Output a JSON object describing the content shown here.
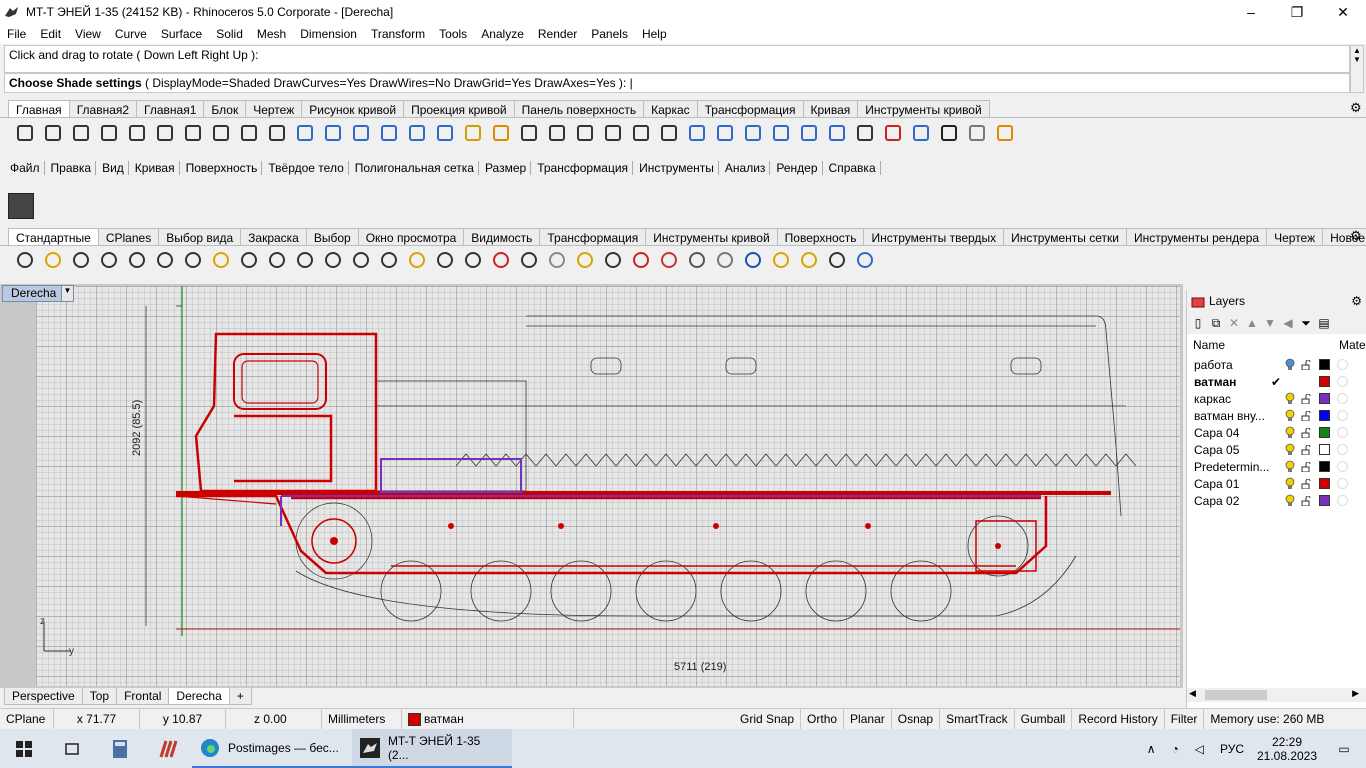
{
  "titlebar": {
    "title": "MT-T ЭНЕЙ 1-35 (24152 KB) - Rhinoceros  5.0 Corporate - [Derecha]",
    "minimize": "–",
    "maximize": "❐",
    "close": "✕"
  },
  "menu": [
    "File",
    "Edit",
    "View",
    "Curve",
    "Surface",
    "Solid",
    "Mesh",
    "Dimension",
    "Transform",
    "Tools",
    "Analyze",
    "Render",
    "Panels",
    "Help"
  ],
  "command": {
    "history": "Click and drag to rotate ( Down  Left  Right  Up ):",
    "prompt_bold": "Choose Shade settings",
    "prompt_rest": " ( DisplayMode=Shaded  DrawCurves=Yes  DrawWires=No  DrawGrid=Yes  DrawAxes=Yes ): |"
  },
  "tabs_top": [
    "Главная",
    "Главная2",
    "Главная1",
    "Блок",
    "Чертеж",
    "Рисунок кривой",
    "Проекция кривой",
    "Панель поверхность",
    "Каркас",
    "Трансформация",
    "Кривая",
    "Инструменты кривой"
  ],
  "tabs_top_active": 0,
  "legacy_menu": [
    "Файл",
    "Правка",
    "Вид",
    "Кривая",
    "Поверхность",
    "Твёрдое тело",
    "Полигональная сетка",
    "Размер",
    "Трансформация",
    "Инструменты",
    "Анализ",
    "Рендер",
    "Справка"
  ],
  "tabs_std": [
    "Стандартные",
    "CPlanes",
    "Выбор вида",
    "Закраска",
    "Выбор",
    "Окно просмотра",
    "Видимость",
    "Трансформация",
    "Инструменты кривой",
    "Поверхность",
    "Инструменты твердых",
    "Инструменты сетки",
    "Инструменты рендера",
    "Чертеж",
    "Новое в"
  ],
  "tabs_std_active": 0,
  "viewport": {
    "label": "Derecha",
    "dim_vertical": "2092 (85.5)",
    "dim_horizontal": "5711 (219)",
    "axis_z": "z",
    "axis_y": "y"
  },
  "view_tabs": [
    "Perspective",
    "Top",
    "Frontal",
    "Derecha",
    "+"
  ],
  "view_tabs_active": 3,
  "layers": {
    "title": "Layers",
    "col_name": "Name",
    "col_material": "Mater",
    "rows": [
      {
        "name": "работа",
        "current": "",
        "bulb": "#4a90d9",
        "color": "#000000",
        "bold": false
      },
      {
        "name": "ватман",
        "current": "✔",
        "bulb": "",
        "color": "#d40000",
        "bold": true
      },
      {
        "name": "каркас",
        "current": "",
        "bulb": "#f5d000",
        "color": "#7b2fbe",
        "bold": false
      },
      {
        "name": "ватман вну...",
        "current": "",
        "bulb": "#f5d000",
        "color": "#0000ff",
        "bold": false
      },
      {
        "name": "Capa 04",
        "current": "",
        "bulb": "#f5d000",
        "color": "#118811",
        "bold": false
      },
      {
        "name": "Capa 05",
        "current": "",
        "bulb": "#f5d000",
        "color": "#ffffff",
        "bold": false
      },
      {
        "name": "Predetermin...",
        "current": "",
        "bulb": "#f5d000",
        "color": "#000000",
        "bold": false
      },
      {
        "name": "Capa 01",
        "current": "",
        "bulb": "#f5d000",
        "color": "#d40000",
        "bold": false
      },
      {
        "name": "Capa 02",
        "current": "",
        "bulb": "#f5d000",
        "color": "#7b2fbe",
        "bold": false
      }
    ]
  },
  "status": {
    "cplane": "CPlane",
    "x": "x 71.77",
    "y": "y 10.87",
    "z": "z 0.00",
    "units": "Millimeters",
    "layer": "ватман",
    "layer_color": "#d40000",
    "toggles": [
      "Grid Snap",
      "Ortho",
      "Planar",
      "Osnap",
      "SmartTrack",
      "Gumball",
      "Record History",
      "Filter"
    ],
    "memory": "Memory use: 260 MB"
  },
  "taskbar": {
    "app1": "Postimages — бес...",
    "app2": "MT-T ЭНЕЙ 1-35 (2...",
    "lang": "РУС",
    "time": "22:29",
    "date": "21.08.2023"
  }
}
